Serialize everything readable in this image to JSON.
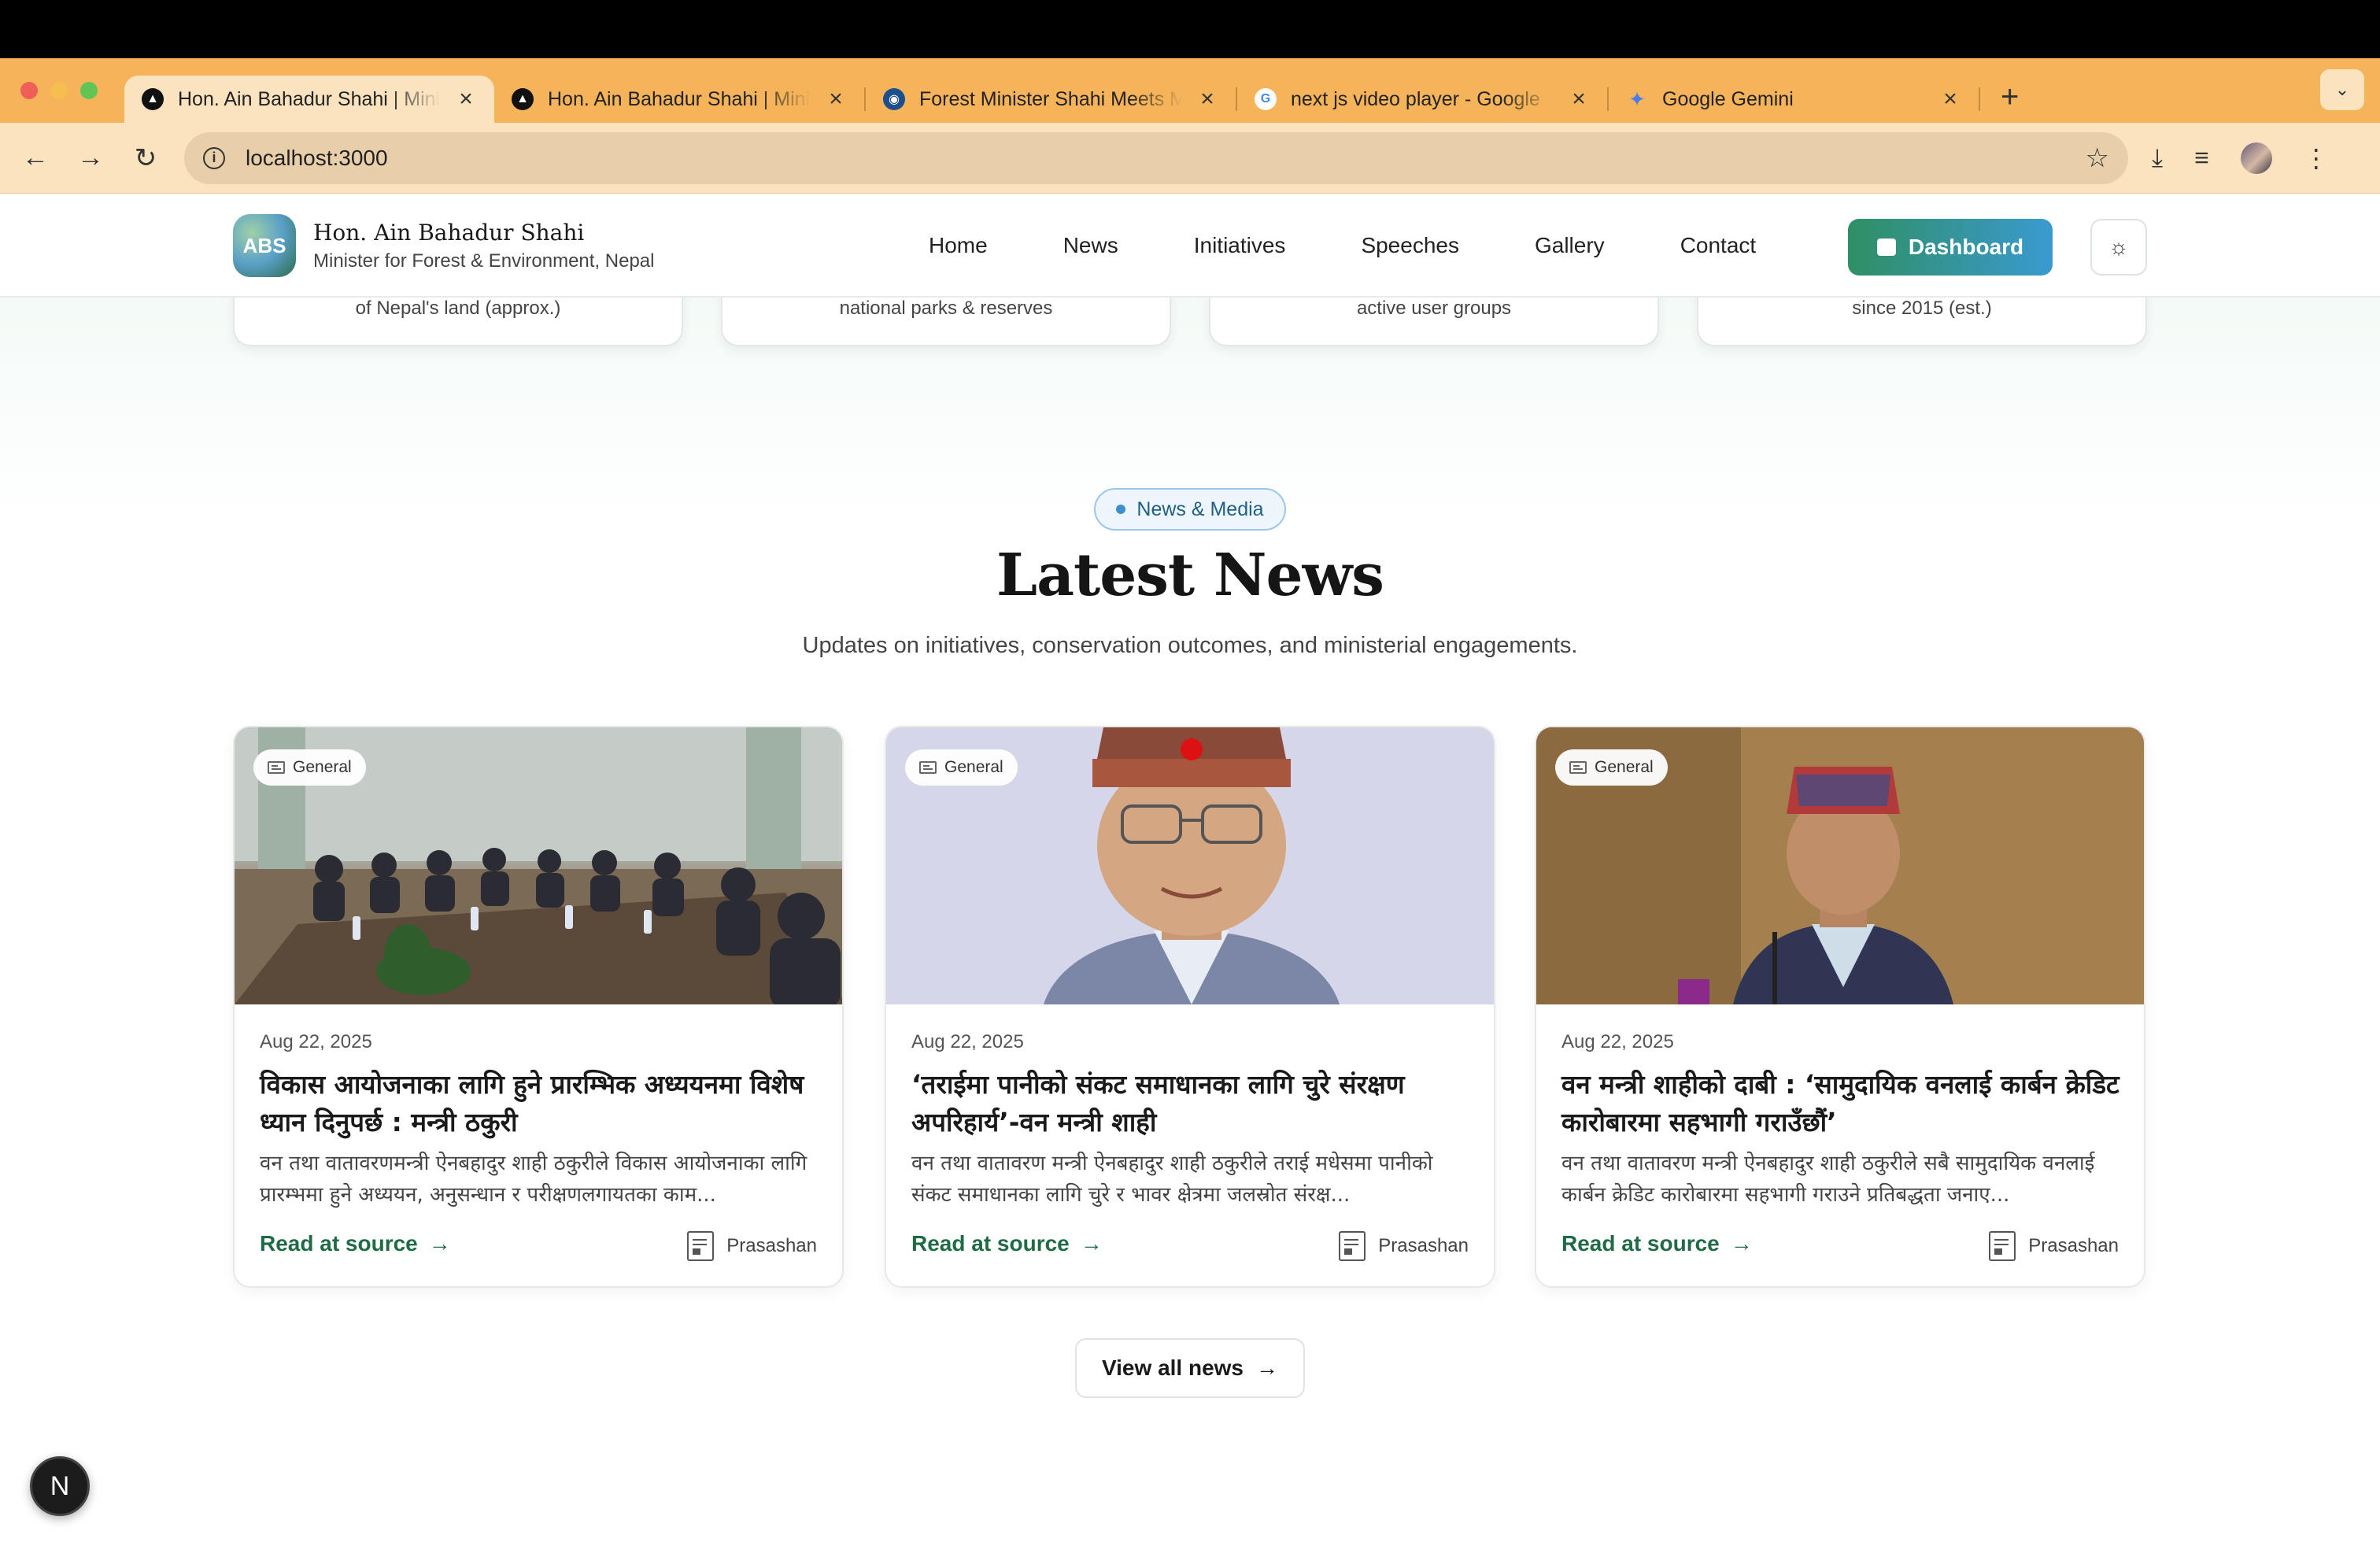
{
  "browser": {
    "tabs": [
      {
        "title": "Hon. Ain Bahadur Shahi | Mini",
        "active": true
      },
      {
        "title": "Hon. Ain Bahadur Shahi | Mini",
        "active": false
      },
      {
        "title": "Forest Minister Shahi Meets M",
        "active": false
      },
      {
        "title": "next js video player - Google",
        "active": false
      },
      {
        "title": "Google Gemini",
        "active": false
      }
    ],
    "url": "localhost:3000",
    "traffic_colors": [
      "#ee5f57",
      "#f6bd4f",
      "#61c454"
    ]
  },
  "site": {
    "brand_logo": "ABS",
    "brand_name": "Hon. Ain Bahadur Shahi",
    "brand_sub": "Minister for Forest & Environment, Nepal",
    "nav": [
      "Home",
      "News",
      "Initiatives",
      "Speeches",
      "Gallery",
      "Contact"
    ],
    "dashboard_label": "Dashboard",
    "accent": "#2f8f63"
  },
  "stats": [
    {
      "caption": "of Nepal's land (approx.)"
    },
    {
      "caption": "national parks & reserves"
    },
    {
      "caption": "active user groups"
    },
    {
      "caption": "since 2015 (est.)"
    }
  ],
  "news": {
    "pill": "News & Media",
    "title": "Latest News",
    "subtitle": "Updates on initiatives, conservation outcomes, and ministerial engagements.",
    "cards": [
      {
        "badge": "General",
        "date": "Aug 22, 2025",
        "title": "विकास आयोजनाका लागि हुने प्रारम्भिक अध्ययनमा विशेष ध्यान दिनुपर्छ : मन्त्री ठकुरी",
        "excerpt": "वन तथा वातावरणमन्त्री ऐनबहादुर शाही ठकुरीले विकास आयोजनाका लागि प्रारम्भमा हुने अध्ययन, अनुसन्धान र परीक्षणलगायतका काम...",
        "link": "Read at source",
        "source": "Prasashan"
      },
      {
        "badge": "General",
        "date": "Aug 22, 2025",
        "title": "‘तराईमा पानीको संकट समाधानका लागि चुरे संरक्षण अपरिहार्य’-वन मन्त्री शाही",
        "excerpt": "वन तथा वातावरण मन्त्री ऐनबहादुर शाही ठकुरीले तराई मधेसमा पानीको संकट समाधानका लागि चुरे र भावर क्षेत्रमा जलस्रोत संरक्ष...",
        "link": "Read at source",
        "source": "Prasashan"
      },
      {
        "badge": "General",
        "date": "Aug 22, 2025",
        "title": "वन मन्त्री शाहीको दाबी : ‘सामुदायिक वनलाई कार्बन क्रेडिट कारोबारमा सहभागी गराउँछौं’",
        "excerpt": "वन तथा वातावरण मन्त्री ऐनबहादुर शाही ठकुरीले सबै सामुदायिक वनलाई कार्बन क्रेडिट कारोबारमा सहभागी गराउने प्रतिबद्धता जनाए...",
        "link": "Read at source",
        "source": "Prasashan"
      }
    ],
    "view_all": "View all news"
  },
  "dev": {
    "badge": "N"
  }
}
